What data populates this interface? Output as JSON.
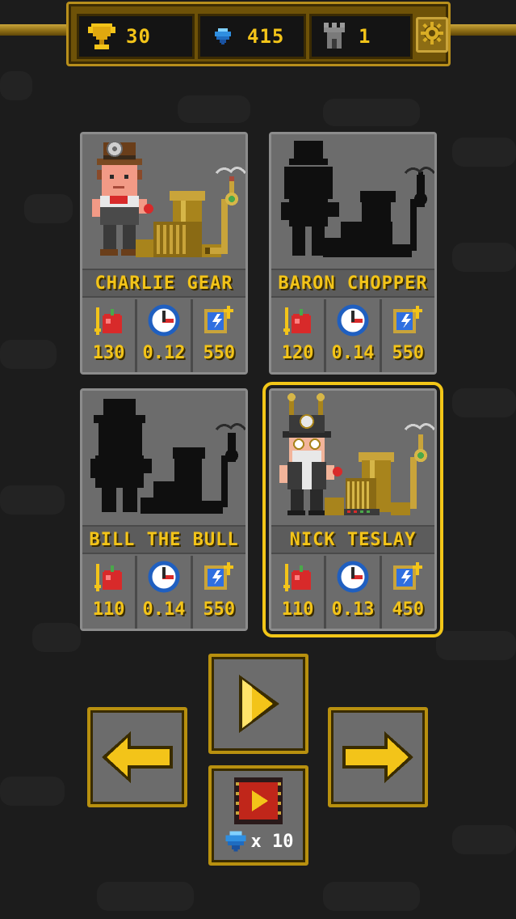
{
  "topbar": {
    "trophies": "30",
    "gems": "415",
    "towers": "1",
    "trophy_icon": "trophy-icon",
    "gem_icon": "gem-icon",
    "tower_icon": "tower-icon",
    "settings_icon": "gear-icon"
  },
  "characters": [
    {
      "name": "CHARLIE GEAR",
      "apples": "130",
      "speed": "0.12",
      "energy": "550",
      "unlocked": true,
      "selected": false
    },
    {
      "name": "BARON CHOPPER",
      "apples": "120",
      "speed": "0.14",
      "energy": "550",
      "unlocked": false,
      "selected": false
    },
    {
      "name": "BILL THE BULL",
      "apples": "110",
      "speed": "0.14",
      "energy": "550",
      "unlocked": false,
      "selected": false
    },
    {
      "name": "NICK TESLAY",
      "apples": "110",
      "speed": "0.13",
      "energy": "450",
      "unlocked": true,
      "selected": true
    }
  ],
  "controls": {
    "play_icon": "play-icon",
    "left_icon": "arrow-left-icon",
    "right_icon": "arrow-right-icon",
    "video_icon": "video-reward-icon",
    "video_reward": "x 10"
  },
  "colors": {
    "accent_gold": "#f3c419",
    "frame_gold": "#b8900f",
    "card_grey": "#6c6c6c",
    "background": "#1c1c1c"
  }
}
